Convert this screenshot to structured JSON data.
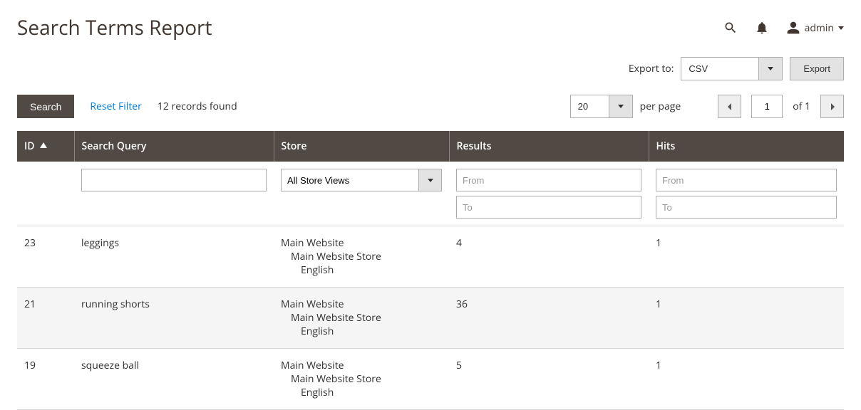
{
  "header": {
    "title": "Search Terms Report",
    "user_label": "admin"
  },
  "export": {
    "label": "Export to:",
    "selected": "CSV",
    "button": "Export"
  },
  "toolbar": {
    "search_label": "Search",
    "reset_label": "Reset Filter",
    "records_found": "12 records found",
    "page_size": "20",
    "per_page_label": "per page",
    "current_page": "1",
    "of_label": "of 1"
  },
  "columns": {
    "id": "ID",
    "query": "Search Query",
    "store": "Store",
    "results": "Results",
    "hits": "Hits"
  },
  "filters": {
    "store_selected": "All Store Views",
    "from_placeholder": "From",
    "to_placeholder": "To"
  },
  "rows": [
    {
      "id": "23",
      "query": "leggings",
      "store_l1": "Main Website",
      "store_l2": "Main Website Store",
      "store_l3": "English",
      "results": "4",
      "hits": "1"
    },
    {
      "id": "21",
      "query": "running shorts",
      "store_l1": "Main Website",
      "store_l2": "Main Website Store",
      "store_l3": "English",
      "results": "36",
      "hits": "1"
    },
    {
      "id": "19",
      "query": "squeeze ball",
      "store_l1": "Main Website",
      "store_l2": "Main Website Store",
      "store_l3": "English",
      "results": "5",
      "hits": "1"
    }
  ]
}
